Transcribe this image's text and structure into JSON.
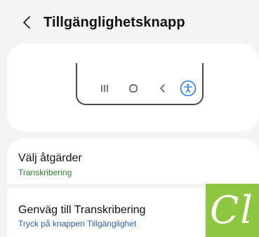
{
  "header": {
    "back_icon": "chevron-left-icon",
    "title": "Tillgänglighetsknapp"
  },
  "preview": {
    "nav_icons": [
      "recents-icon",
      "home-icon",
      "back-icon",
      "accessibility-icon"
    ],
    "accent_color": "#2a7de1"
  },
  "actions": {
    "title": "Välj åtgärder",
    "subtitle": "Transkribering",
    "subtitle_color": "#2e7d32"
  },
  "shortcut": {
    "title": "Genväg till Transkribering",
    "subtitle": "Tryck på knappen Tillgänglighet",
    "subtitle_color": "#2d5fa8"
  },
  "logo": {
    "text": "Cl",
    "background": "#8dc63f"
  }
}
